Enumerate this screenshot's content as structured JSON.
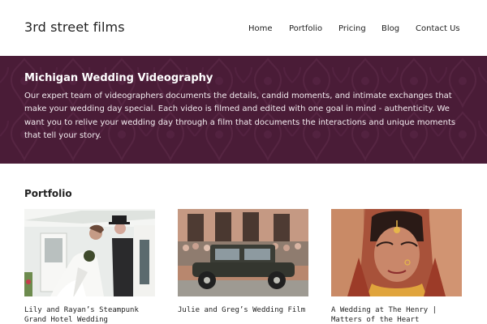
{
  "brand": "3rd street films",
  "nav": {
    "items": [
      {
        "label": "Home"
      },
      {
        "label": "Portfolio"
      },
      {
        "label": "Pricing"
      },
      {
        "label": "Blog"
      },
      {
        "label": "Contact Us"
      }
    ]
  },
  "hero": {
    "title": "Michigan Wedding Videography",
    "text": "Our expert team of videographers documents the details, candid moments, and intimate exchanges that make your wedding day special. Each video is filmed and edited with one goal in mind - authenticity. We want you to relive your wedding day through a film that documents the interactions and unique moments that tell your story.",
    "bg_color": "#4a1c37"
  },
  "portfolio": {
    "title": "Portfolio",
    "items": [
      {
        "title": "Lily and Rayan’s Steampunk\nGrand Hotel Wedding"
      },
      {
        "title": "Julie and Greg’s Wedding Film"
      },
      {
        "title": "A Wedding at The Henry |\nMatters of the Heart"
      }
    ]
  }
}
